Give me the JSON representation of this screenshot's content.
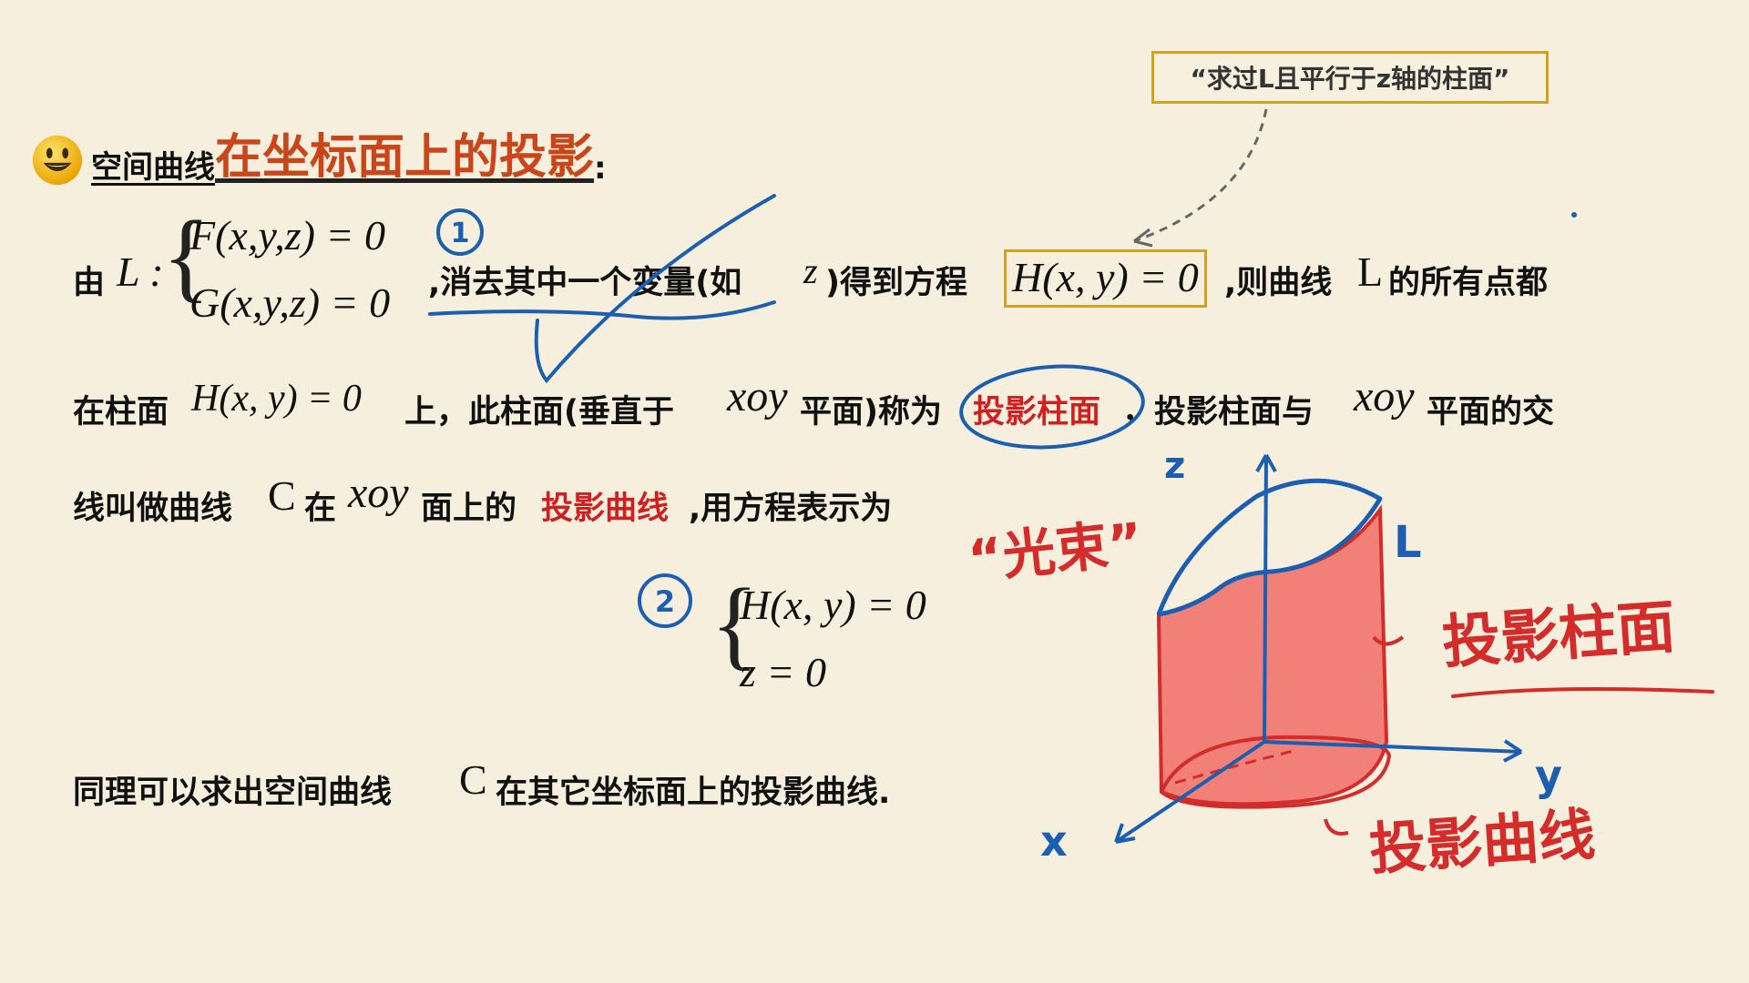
{
  "title": {
    "prefix": "空间曲线",
    "emphasis": "在坐标面上的投影",
    "suffix": ":"
  },
  "callout": "“求过L且平行于z轴的柱面”",
  "line1": {
    "you": "由",
    "L_colon": "L :",
    "eq_F": "F(x,y,z) = 0",
    "eq_G": "G(x,y,z) = 0",
    "text_a": ",消去其中一个变量(如",
    "z": "z",
    "text_b": ")得到方程",
    "boxed_eq": "H(x, y) = 0",
    "text_c": ",则曲线",
    "L": "L",
    "text_d": "的所有点都"
  },
  "line2": {
    "text_a": "在柱面",
    "eq": "H(x, y) = 0",
    "text_b": "上，此柱面(垂直于",
    "xoy1": "xoy",
    "text_c": "平面)称为",
    "red_term": "投影柱面",
    "text_d": "，投影柱面与",
    "xoy2": "xoy",
    "text_e": "平面的交"
  },
  "line3": {
    "text_a": "线叫做曲线",
    "C": "C",
    "text_b": "在",
    "xoy": "xoy",
    "text_c": "面上的",
    "red_term": "投影曲线",
    "text_d": ",用方程表示为"
  },
  "system2": {
    "eq_H": "H(x, y) = 0",
    "eq_z": "z = 0"
  },
  "line4": {
    "text_a": "同理可以求出空间曲线",
    "C": "C",
    "text_b": "在其它坐标面上的投影曲线."
  },
  "annotations": {
    "circle_1": "1",
    "circle_2": "2",
    "guangshu": "“光束”",
    "axis_z": "z",
    "axis_y": "y",
    "axis_x": "x",
    "label_L": "L",
    "proj_cylinder": "投影柱面",
    "proj_curve": "投影曲线"
  },
  "colors": {
    "background": "#f7efdd",
    "title_emphasis": "#c8461a",
    "red_term": "#d11f1f",
    "ink_blue": "#1c5fb0",
    "ink_red": "#d42b2b",
    "cylinder_fill": "#f08078",
    "box_border": "#d4a021"
  }
}
